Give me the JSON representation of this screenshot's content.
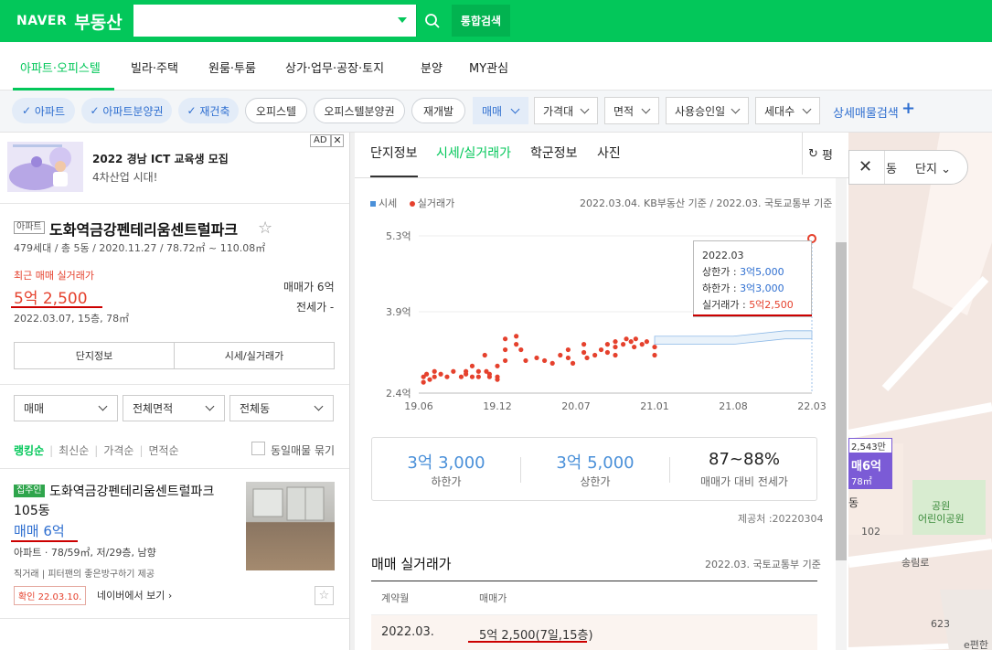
{
  "header": {
    "logo_naver": "NAVER",
    "logo_brand": "부동산",
    "search_placeholder": "",
    "total_search": "통합검색"
  },
  "nav": {
    "items": [
      "아파트·오피스텔",
      "빌라·주택",
      "원룸·투룸",
      "상가·업무·공장·토지",
      "분양",
      "MY관심"
    ]
  },
  "filters": {
    "chips": [
      "아파트",
      "아파트분양권",
      "재건축",
      "오피스텔",
      "오피스텔분양권",
      "재개발"
    ],
    "dropdowns": [
      "매매",
      "가격대",
      "면적",
      "사용승인일",
      "세대수"
    ],
    "detail_search": "상세매물검색",
    "plus": "+"
  },
  "ad": {
    "title": "2022 경남 ICT 교육생 모집",
    "sub": "4차산업 시대!",
    "badge": "AD",
    "close": "✕"
  },
  "complex": {
    "badge": "아파트",
    "name": "도화역금강펜테리움센트럴파크",
    "star": "☆",
    "info": "479세대 / 총 5동 / 2020.11.27 / 78.72㎡ ~ 110.08㎡",
    "recent_label": "최근 매매 실거래가",
    "recent_price": "5억 2,500",
    "recent_date": "2022.03.07, 15층, 78㎡",
    "sale_label": "매매가 6억",
    "jeonse_label": "전세가 -",
    "btn_info": "단지정보",
    "btn_price": "시세/실거래가"
  },
  "list_filters": {
    "trade": "매매",
    "area": "전체면적",
    "dong": "전체동"
  },
  "sort": {
    "items": [
      "랭킹순",
      "최신순",
      "가격순",
      "면적순"
    ],
    "same_label": "동일매물 묶기"
  },
  "listing": {
    "broker_badge": "집주인",
    "name": "도화역금강펜테리움센트럴파크",
    "dong": "105동",
    "price": "매매 6억",
    "spec": "아파트 · 78/59㎡, 저/29층, 남향",
    "desc": "직거래 | 피터팬의 좋은방구하기 제공",
    "confirm": "확인 22.03.10.",
    "naver_view": "네이버에서 보기",
    "star": "☆"
  },
  "detail": {
    "tabs": [
      "단지정보",
      "시세/실거래가",
      "학군정보",
      "사진"
    ],
    "refresh": "평",
    "legend_market": "시세",
    "legend_real": "실거래가",
    "source_note": "2022.03.04. KB부동산 기준 / 2022.03. 국토교통부 기준",
    "tooltip": {
      "month": "2022.03",
      "upper_label": "상한가 : ",
      "upper_value": "3억5,000",
      "lower_label": "하한가 : ",
      "lower_value": "3억3,000",
      "real_label": "실거래가 : ",
      "real_value": "5억2,500"
    },
    "summary": [
      {
        "value": "3억 3,000",
        "label": "하한가"
      },
      {
        "value": "3억 5,000",
        "label": "상한가"
      },
      {
        "value": "87~88%",
        "label": "매매가 대비 전세가"
      }
    ],
    "provider": "제공처 :20220304",
    "deals_title": "매매 실거래가",
    "deals_note": "2022.03. 국토교통부 기준",
    "table_headers": [
      "계약월",
      "매매가"
    ],
    "table_rows": [
      {
        "month": "2022.03.",
        "price": "5억 2,500(7일,15층)"
      }
    ]
  },
  "chart_data": {
    "type": "scatter",
    "ytick_labels": [
      "5.3억",
      "3.9억",
      "2.4억"
    ],
    "yticks": [
      5.3,
      3.9,
      2.4
    ],
    "xtick_labels": [
      "19.06",
      "19.12",
      "20.07",
      "21.01",
      "21.08",
      "22.03"
    ],
    "xticks": [
      2019.5,
      2020.0,
      2020.5,
      2021.0,
      2021.5,
      2022.0
    ],
    "ylim": [
      2.4,
      5.3
    ],
    "xlim": [
      2019.5,
      2022.0
    ],
    "series": [
      {
        "name": "실거래가",
        "color": "#e5412d",
        "points": [
          [
            2019.53,
            2.7
          ],
          [
            2019.53,
            2.6
          ],
          [
            2019.55,
            2.75
          ],
          [
            2019.57,
            2.65
          ],
          [
            2019.6,
            2.8
          ],
          [
            2019.6,
            2.7
          ],
          [
            2019.64,
            2.75
          ],
          [
            2019.68,
            2.7
          ],
          [
            2019.72,
            2.8
          ],
          [
            2019.77,
            2.7
          ],
          [
            2019.8,
            2.8
          ],
          [
            2019.8,
            2.75
          ],
          [
            2019.84,
            2.9
          ],
          [
            2019.84,
            2.7
          ],
          [
            2019.88,
            2.8
          ],
          [
            2019.88,
            2.7
          ],
          [
            2019.92,
            3.1
          ],
          [
            2019.93,
            2.8
          ],
          [
            2019.95,
            2.75
          ],
          [
            2019.95,
            2.7
          ],
          [
            2020.0,
            2.9
          ],
          [
            2020.0,
            2.7
          ],
          [
            2020.0,
            2.65
          ],
          [
            2020.05,
            3.4
          ],
          [
            2020.05,
            3.2
          ],
          [
            2020.05,
            3.0
          ],
          [
            2020.12,
            3.45
          ],
          [
            2020.12,
            3.3
          ],
          [
            2020.15,
            3.2
          ],
          [
            2020.18,
            3.0
          ],
          [
            2020.25,
            3.05
          ],
          [
            2020.3,
            3.0
          ],
          [
            2020.35,
            2.95
          ],
          [
            2020.4,
            3.1
          ],
          [
            2020.45,
            3.2
          ],
          [
            2020.45,
            3.05
          ],
          [
            2020.48,
            2.95
          ],
          [
            2020.55,
            3.3
          ],
          [
            2020.55,
            3.15
          ],
          [
            2020.57,
            3.05
          ],
          [
            2020.62,
            3.1
          ],
          [
            2020.66,
            3.2
          ],
          [
            2020.7,
            3.3
          ],
          [
            2020.7,
            3.15
          ],
          [
            2020.75,
            3.35
          ],
          [
            2020.75,
            3.25
          ],
          [
            2020.75,
            3.1
          ],
          [
            2020.8,
            3.3
          ],
          [
            2020.82,
            3.4
          ],
          [
            2020.85,
            3.35
          ],
          [
            2020.87,
            3.25
          ],
          [
            2020.88,
            3.4
          ],
          [
            2020.92,
            3.3
          ],
          [
            2020.95,
            3.35
          ],
          [
            2021.0,
            3.1
          ],
          [
            2021.0,
            3.25
          ],
          [
            2022.0,
            5.25
          ]
        ]
      }
    ],
    "band": {
      "name": "시세",
      "color": "#4a90d9",
      "lower": [
        [
          2021.0,
          3.3
        ],
        [
          2021.5,
          3.3
        ],
        [
          2021.83,
          3.4
        ],
        [
          2022.0,
          3.4
        ]
      ],
      "upper": [
        [
          2021.0,
          3.45
        ],
        [
          2021.5,
          3.45
        ],
        [
          2021.83,
          3.55
        ],
        [
          2022.0,
          3.55
        ]
      ]
    }
  },
  "map": {
    "dong": "동",
    "danji": "단지",
    "labels": [
      "2,543만",
      "매6억",
      "78㎡",
      "동",
      "공원",
      "어린이공원",
      "102",
      "송림로",
      "623",
      "e편한"
    ]
  }
}
